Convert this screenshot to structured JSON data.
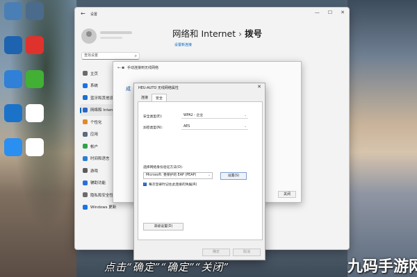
{
  "desktop": {
    "icons": [
      {
        "label": "",
        "color": "#4a7fb5"
      },
      {
        "label": "",
        "color": "#4b6b8c"
      },
      {
        "label": "",
        "color": "#1e63b0"
      },
      {
        "label": "",
        "color": "#e0322c"
      },
      {
        "label": "",
        "color": "#2f80d6"
      },
      {
        "label": "",
        "color": "#41b035"
      },
      {
        "label": "",
        "color": "#1a73c9"
      },
      {
        "label": "",
        "color": "#ffffff"
      },
      {
        "label": "",
        "color": "#2a8ff0"
      },
      {
        "label": "",
        "color": "#ffffff"
      }
    ]
  },
  "settings_window": {
    "app_title": "设置",
    "breadcrumb_parent": "网络和 Internet",
    "breadcrumb_separator": "›",
    "breadcrumb_current": "拨号",
    "setup_link": "设置新连接",
    "search_placeholder": "查找设置",
    "sidebar": [
      {
        "label": "主页",
        "color": "#6b6b6b"
      },
      {
        "label": "系统",
        "color": "#1a73e8"
      },
      {
        "label": "蓝牙和其他设备",
        "color": "#1f6fd1"
      },
      {
        "label": "网络和 Internet",
        "color": "#2b65c4"
      },
      {
        "label": "个性化",
        "color": "#e08a2b"
      },
      {
        "label": "应用",
        "color": "#5d6b7a"
      },
      {
        "label": "帐户",
        "color": "#2ea34a"
      },
      {
        "label": "时间和语言",
        "color": "#2d7dd2"
      },
      {
        "label": "游戏",
        "color": "#5c5c5c"
      },
      {
        "label": "辅助功能",
        "color": "#2b6fd6"
      },
      {
        "label": "隐私和安全性",
        "color": "#6b6b6b"
      },
      {
        "label": "Windows 更新",
        "color": "#1a73e8"
      }
    ],
    "active_index": 3
  },
  "background_dialog": {
    "title": "手动连接到无线网络",
    "partial_heading": "成",
    "close_label": "关闭"
  },
  "properties_dialog": {
    "title": "HEU-AUTO 无线网络属性",
    "tabs": [
      "连接",
      "安全"
    ],
    "active_tab": 1,
    "security_type_label": "安全类型(E):",
    "security_type_value": "WPA2 - 企业",
    "encryption_type_label": "加密类型(N):",
    "encryption_type_value": "AES",
    "auth_method_label": "选择网络身份验证方法(O):",
    "auth_method_value": "Microsoft: 受保护的 EAP (PEAP)",
    "settings_button": "设置(S)",
    "remember_checkbox_label": "每次登录时记住此连接的凭据(R)",
    "remember_checked": true,
    "advanced_button": "高级设置(D)",
    "ok_button": "确定",
    "cancel_button": "取消"
  },
  "overlay": {
    "caption": "点击“确定”“确定”“关闭”",
    "watermark": "九码手游网"
  }
}
